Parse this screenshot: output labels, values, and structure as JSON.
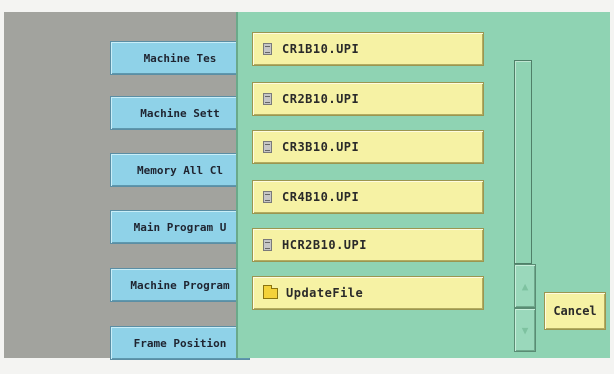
{
  "menu": {
    "items": [
      {
        "label": "Machine Tes"
      },
      {
        "label": "Machine Sett"
      },
      {
        "label": "Memory All Cl"
      },
      {
        "label": "Main Program U"
      },
      {
        "label": "Machine Program"
      },
      {
        "label": "Frame Position"
      }
    ]
  },
  "file_dialog": {
    "files": [
      {
        "name": "CR1B10.UPI",
        "icon": "file-icon"
      },
      {
        "name": "CR2B10.UPI",
        "icon": "file-icon"
      },
      {
        "name": "CR3B10.UPI",
        "icon": "file-icon"
      },
      {
        "name": "CR4B10.UPI",
        "icon": "file-icon"
      },
      {
        "name": "HCR2B10.UPI",
        "icon": "file-icon"
      },
      {
        "name": "UpdateFile",
        "icon": "folder-icon"
      }
    ],
    "cancel_label": "Cancel",
    "scroll_up_icon": "up-arrow-icon",
    "scroll_down_icon": "down-arrow-icon",
    "colors": {
      "dialog_bg": "#8fd3b3",
      "item_bg": "#f6f2a4",
      "menu_bg": "#8fd2e8",
      "screen_bg": "#a2a39e"
    }
  }
}
